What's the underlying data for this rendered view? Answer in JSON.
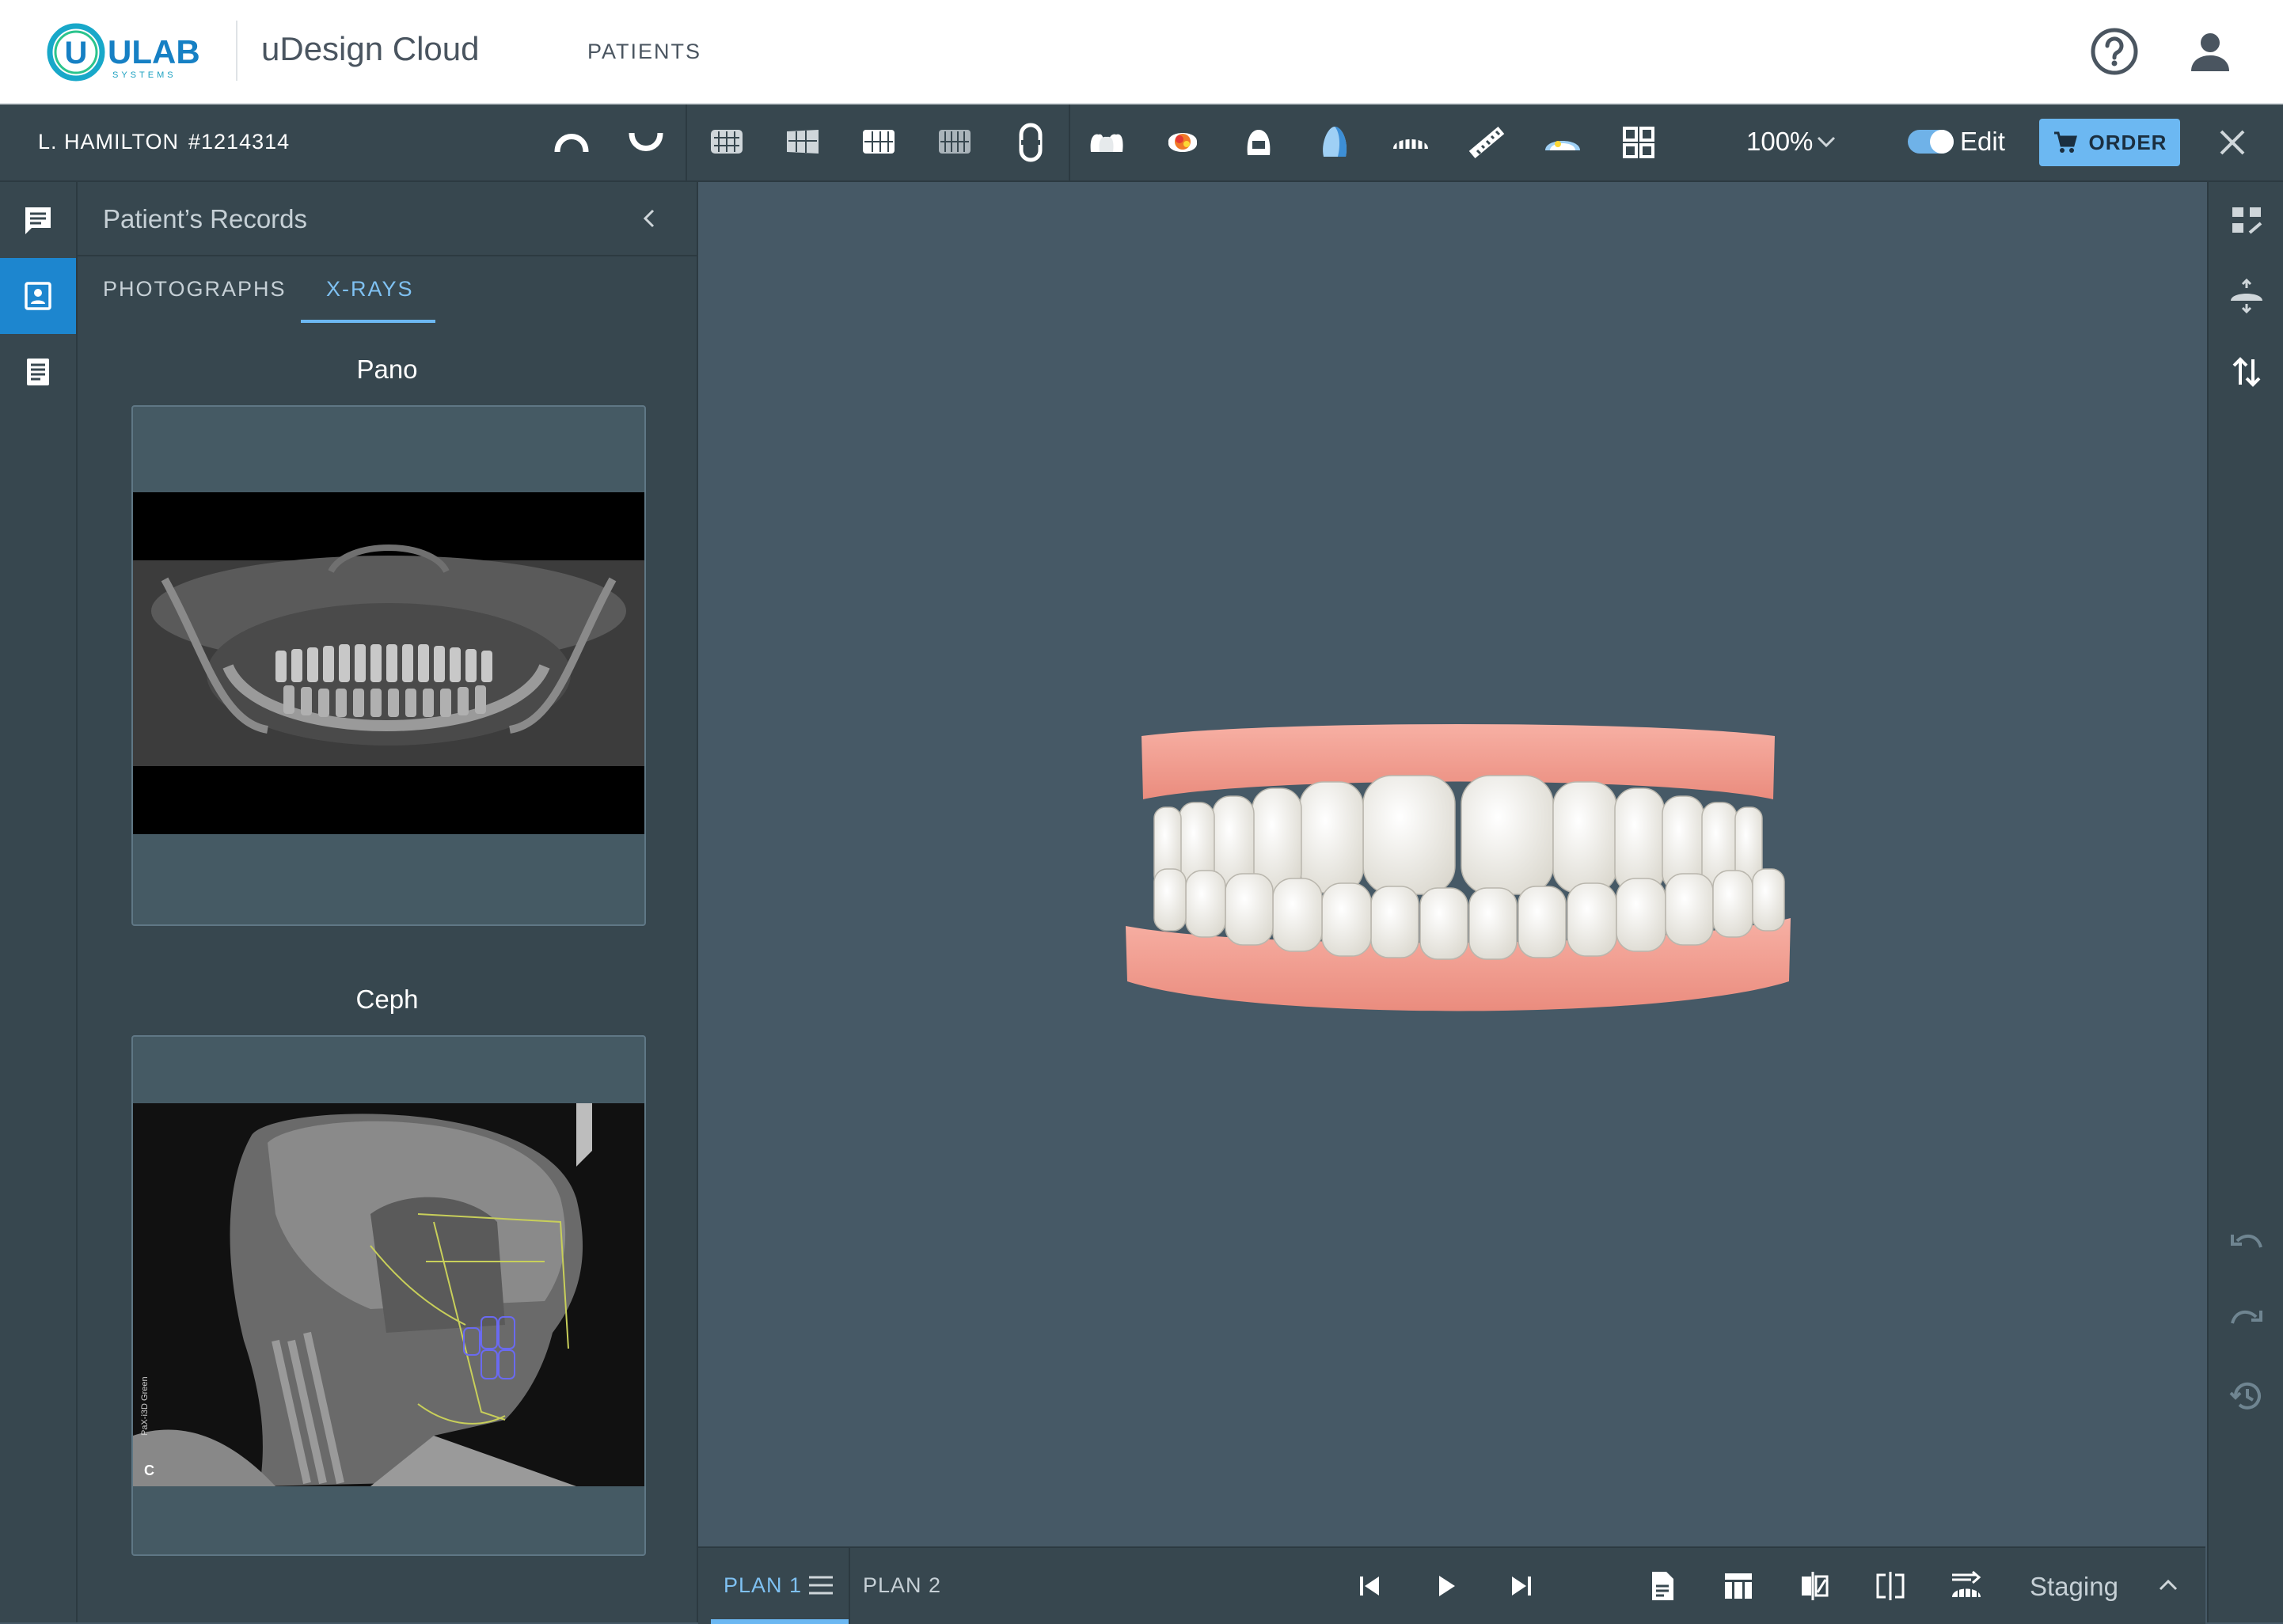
{
  "header": {
    "logo_text": "ULAB",
    "logo_sub": "SYSTEMS",
    "app_title": "uDesign Cloud",
    "nav_patients": "PATIENTS",
    "icons": [
      "help-icon",
      "user-icon"
    ]
  },
  "toolbar": {
    "patient_name": "L. HAMILTON",
    "patient_id": "#1214314",
    "zoom": "100%",
    "edit_label": "Edit",
    "edit_enabled": true,
    "order_label": "ORDER",
    "accent": "#6cb8f2"
  },
  "records": {
    "title": "Patient’s Records",
    "tabs": [
      {
        "label": "PHOTOGRAPHS",
        "active": false
      },
      {
        "label": "X-RAYS",
        "active": true
      }
    ],
    "xrays": [
      {
        "label": "Pano"
      },
      {
        "label": "Ceph",
        "watermark": "PaX-i3D Green",
        "corner_mark": "C"
      }
    ]
  },
  "bottom": {
    "plans": [
      {
        "label": "PLAN 1",
        "active": true
      },
      {
        "label": "PLAN 2",
        "active": false
      }
    ],
    "staging_label": "Staging"
  },
  "colors": {
    "panel_bg": "#37474f",
    "viewport_bg": "#465966",
    "active_blue": "#1d86cf",
    "gum": "#f29a8c",
    "tooth": "#f3f1ea"
  }
}
